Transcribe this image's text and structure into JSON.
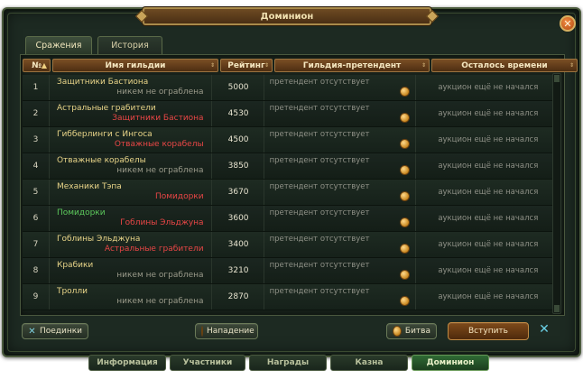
{
  "window": {
    "title": "Доминион"
  },
  "top_tabs": [
    {
      "label": "Сражения",
      "active": true
    },
    {
      "label": "История",
      "active": false
    }
  ],
  "columns": {
    "num": "№",
    "name": "Имя гильдии",
    "rating": "Рейтинг",
    "challenger": "Гильдия-претендент",
    "time_left": "Осталось времени"
  },
  "rows": [
    {
      "num": "1",
      "guild": "Защитники Бастиона",
      "robbed_by": "никем не ограблена",
      "robbed_by_color": "gray",
      "rating": "5000",
      "challenger": "претендент отсутствует",
      "time_left": "аукцион ещё не начался"
    },
    {
      "num": "2",
      "guild": "Астральные грабители",
      "robbed_by": "Защитники Бастиона",
      "robbed_by_color": "red",
      "rating": "4530",
      "challenger": "претендент отсутствует",
      "time_left": "аукцион ещё не начался"
    },
    {
      "num": "3",
      "guild": "Гибберлинги с Ингоса",
      "robbed_by": "Отважные корабелы",
      "robbed_by_color": "red",
      "rating": "4500",
      "challenger": "претендент отсутствует",
      "time_left": "аукцион ещё не начался"
    },
    {
      "num": "4",
      "guild": "Отважные корабелы",
      "robbed_by": "никем не ограблена",
      "robbed_by_color": "gray",
      "rating": "3850",
      "challenger": "претендент отсутствует",
      "time_left": "аукцион ещё не начался"
    },
    {
      "num": "5",
      "guild": "Механики Тэпа",
      "robbed_by": "Помидорки",
      "robbed_by_color": "red",
      "rating": "3670",
      "challenger": "претендент отсутствует",
      "time_left": "аукцион ещё не начался"
    },
    {
      "num": "6",
      "guild": "Помидорки",
      "guild_color": "green",
      "robbed_by": "Гоблины Эльджуна",
      "robbed_by_color": "red",
      "rating": "3600",
      "challenger": "претендент отсутствует",
      "time_left": "аукцион ещё не начался"
    },
    {
      "num": "7",
      "guild": "Гоблины Эльджуна",
      "robbed_by": "Астральные грабители",
      "robbed_by_color": "red",
      "rating": "3400",
      "challenger": "претендент отсутствует",
      "time_left": "аукцион ещё не начался"
    },
    {
      "num": "8",
      "guild": "Крабики",
      "robbed_by": "никем не ограблена",
      "robbed_by_color": "gray",
      "rating": "3210",
      "challenger": "претендент отсутствует",
      "time_left": "аукцион ещё не начался"
    },
    {
      "num": "9",
      "guild": "Тролли",
      "robbed_by": "никем не ограблена",
      "robbed_by_color": "gray",
      "rating": "2870",
      "challenger": "претендент отсутствует",
      "time_left": "аукцион ещё не начался"
    }
  ],
  "buttons": {
    "duels": "Поединки",
    "attack": "Нападение",
    "battle": "Битва",
    "join": "Вступить"
  },
  "nav_tabs": [
    {
      "label": "Информация",
      "active": false
    },
    {
      "label": "Участники",
      "active": false
    },
    {
      "label": "Награды",
      "active": false
    },
    {
      "label": "Казна",
      "active": false
    },
    {
      "label": "Доминион",
      "active": true
    }
  ],
  "colors": {
    "title_gold": "#f0e0b0",
    "guild_name": "#e8d488",
    "guild_own": "#5cc95c",
    "robbed_red": "#e84646",
    "muted": "#8e9086"
  },
  "icons": [
    "close-icon",
    "sort-asc-icon",
    "coin-icon",
    "crossed-swords-icon",
    "scroll-up-icon",
    "scroll-down-icon"
  ]
}
